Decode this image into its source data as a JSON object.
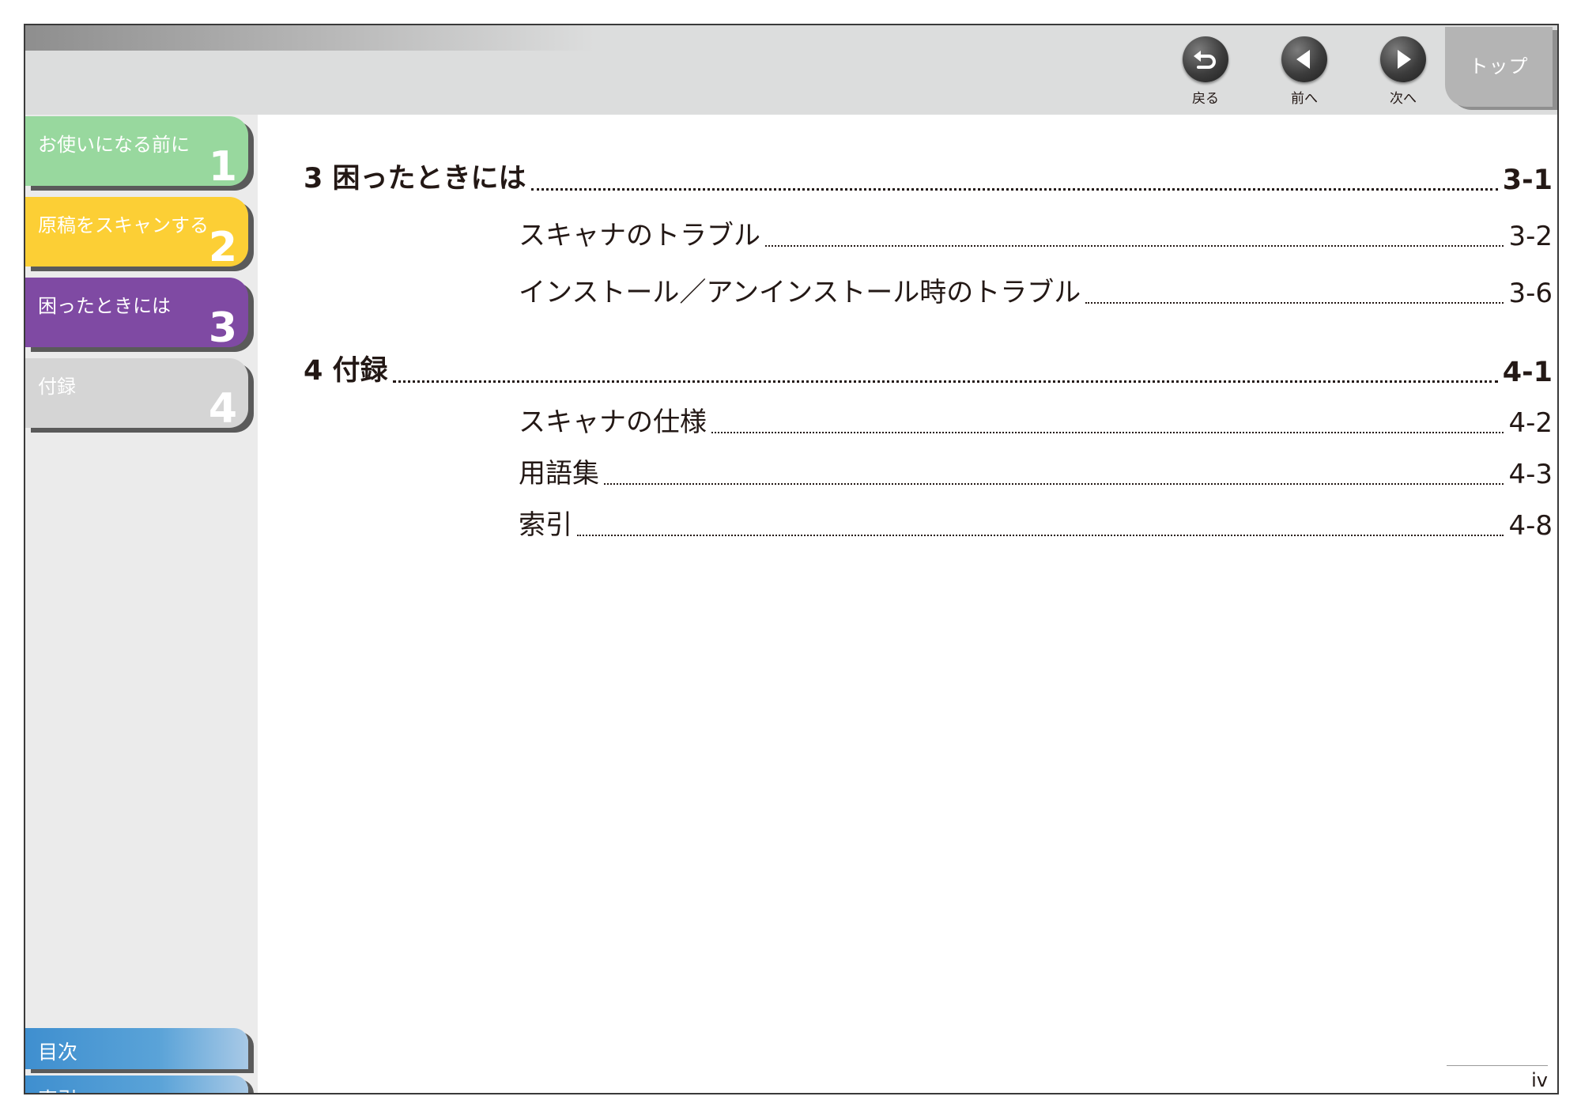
{
  "header": {
    "nav": {
      "back_label": "戻る",
      "prev_label": "前へ",
      "next_label": "次へ",
      "top_label": "トップ"
    }
  },
  "sidebar": {
    "chapters": [
      {
        "title": "お使いになる前に",
        "number": "1",
        "color": "#98d89e"
      },
      {
        "title": "原稿をスキャンする",
        "number": "2",
        "color": "#fccf35"
      },
      {
        "title": "困ったときには",
        "number": "3",
        "color": "#7f4aa3"
      },
      {
        "title": "付録",
        "number": "4",
        "color": "#d5d5d5"
      }
    ],
    "contents_label": "目次",
    "index_label": "索引"
  },
  "toc": {
    "sections": [
      {
        "title": "3 困ったときには",
        "page": "3-1",
        "items": [
          {
            "title": "スキャナのトラブル",
            "page": "3-2"
          },
          {
            "title": "インストール／アンインストール時のトラブル",
            "page": "3-6"
          }
        ]
      },
      {
        "title": "4 付録",
        "page": "4-1",
        "items": [
          {
            "title": "スキャナの仕様",
            "page": "4-2"
          },
          {
            "title": "用語集",
            "page": "4-3"
          },
          {
            "title": "索引",
            "page": "4-8"
          }
        ]
      }
    ]
  },
  "page_number": "iv"
}
